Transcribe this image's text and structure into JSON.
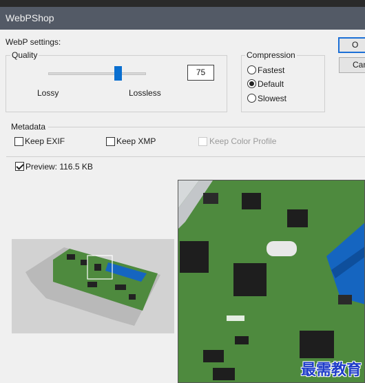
{
  "window": {
    "title": "WebPShop"
  },
  "dialog": {
    "settings_label": "WebP settings:",
    "quality": {
      "group_label": "Quality",
      "value": "75",
      "level": 0.75,
      "lossy_label": "Lossy",
      "lossless_label": "Lossless"
    },
    "compression": {
      "group_label": "Compression",
      "options": [
        "Fastest",
        "Default",
        "Slowest"
      ],
      "selected": "Default"
    },
    "metadata": {
      "group_label": "Metadata",
      "keep_exif": {
        "label": "Keep EXIF",
        "checked": false
      },
      "keep_xmp": {
        "label": "Keep XMP",
        "checked": false
      },
      "keep_color_profile": {
        "label": "Keep Color Profile",
        "checked": false,
        "enabled": false
      }
    },
    "preview": {
      "label": "Preview: 116.5 KB",
      "checked": true
    },
    "buttons": {
      "ok_label": "O",
      "cancel_label": "Can"
    }
  },
  "watermark": "最需教育",
  "colors": {
    "titlebar": "#535a66",
    "dialog_bg": "#f0f0f0",
    "accent": "#0a6fd0",
    "pcb_green": "#4e8a3e",
    "connector_blue": "#1565c0"
  }
}
